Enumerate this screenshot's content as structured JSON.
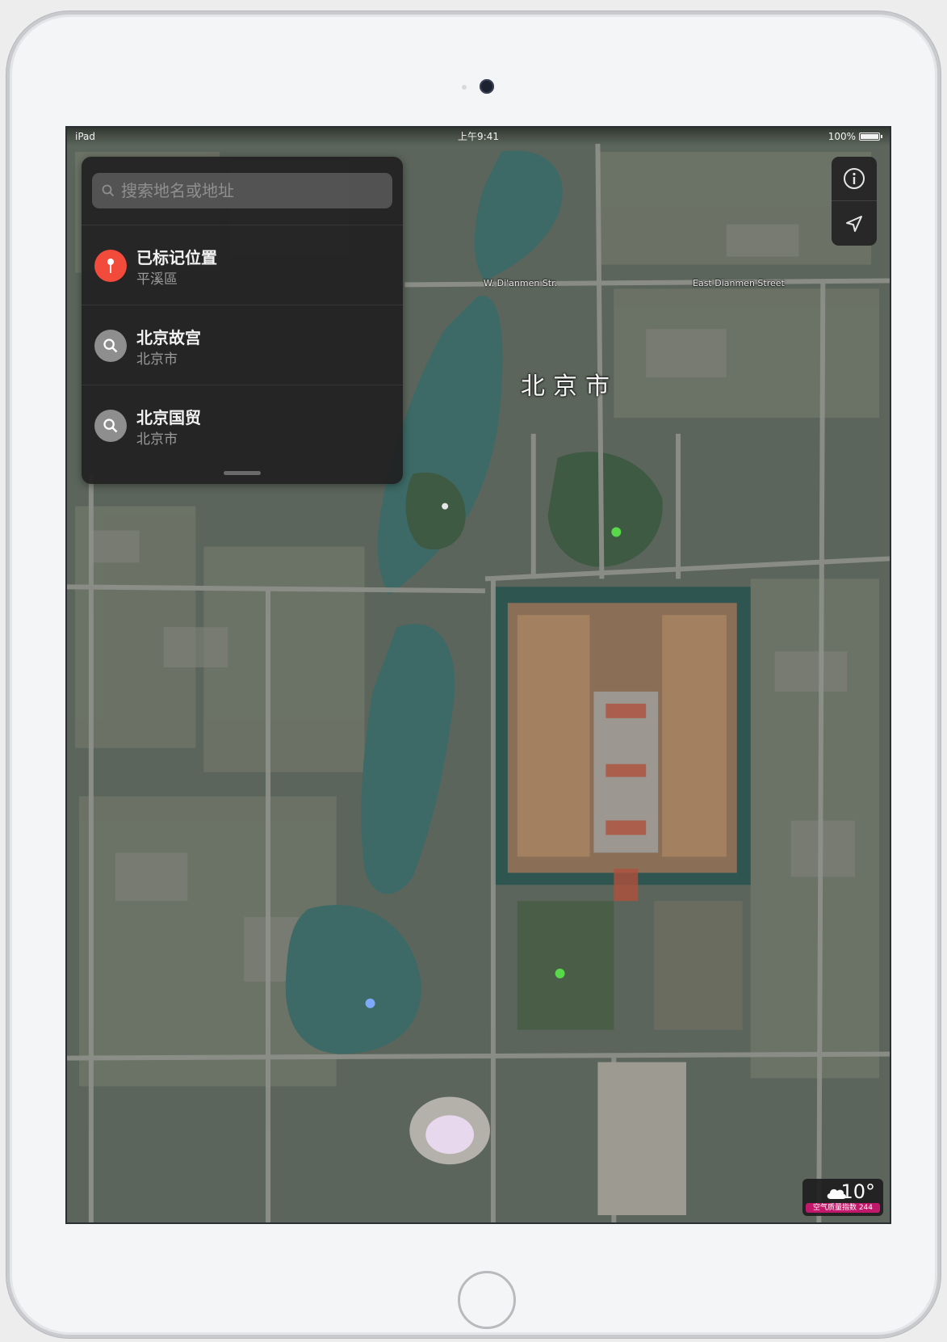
{
  "status_bar": {
    "carrier": "iPad",
    "time": "上午9:41",
    "battery": "100%"
  },
  "search": {
    "placeholder": "搜索地名或地址"
  },
  "results": [
    {
      "title": "已标记位置",
      "subtitle": "平溪區",
      "icon": "pin-icon",
      "color": "#f24b3c"
    },
    {
      "title": "北京故宫",
      "subtitle": "北京市",
      "icon": "search-icon",
      "color": "#8e8e8e"
    },
    {
      "title": "北京国贸",
      "subtitle": "北京市",
      "icon": "search-icon",
      "color": "#8e8e8e"
    }
  ],
  "map": {
    "city_label": "北京市",
    "streets": [
      "W. Di'anmen Str.",
      "East Dianmen Street"
    ],
    "controls": {
      "info": "info-icon",
      "location": "location-arrow-icon"
    }
  },
  "weather": {
    "temp": "10°",
    "aqi": "空气质量指数 244"
  }
}
